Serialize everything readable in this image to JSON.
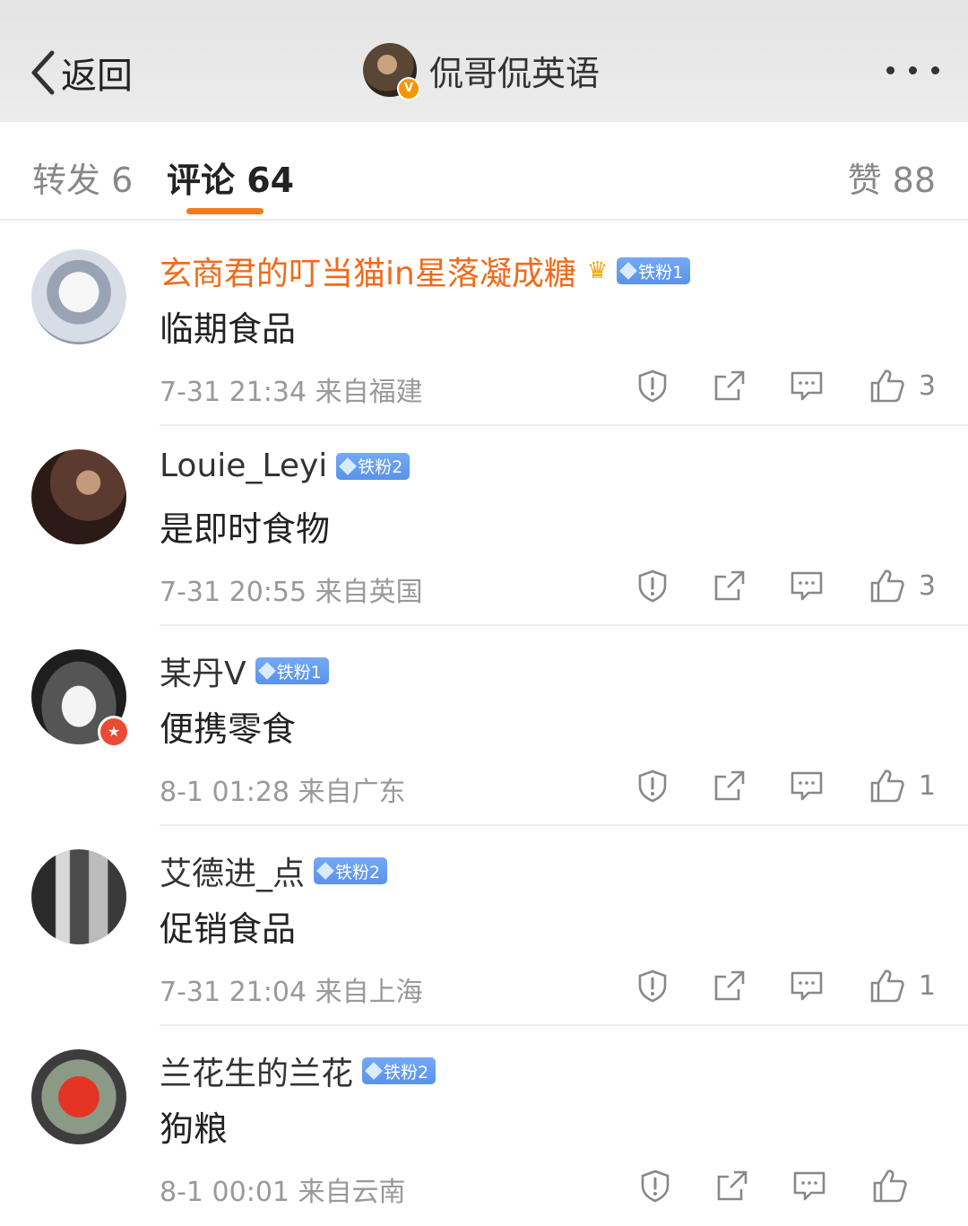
{
  "nav": {
    "back_label": "返回",
    "title": "侃哥侃英语",
    "verified_badge": "V"
  },
  "tabs": [
    {
      "label": "转发 6"
    },
    {
      "label": "评论 64"
    },
    {
      "label": "赞 88"
    }
  ],
  "accent_color": "#f07b1f",
  "comments": [
    {
      "name": "玄商君的叮当猫in星落凝成糖",
      "badge": "铁粉1",
      "text": "临期食品",
      "time": "7-31 21:34",
      "location": "来自福建",
      "likes": "3"
    },
    {
      "name": "Louie_Leyi",
      "badge": "铁粉2",
      "text": "是即时食物",
      "time": "7-31 20:55",
      "location": "来自英国",
      "likes": "3"
    },
    {
      "name": "某丹V",
      "badge": "铁粉1",
      "text": "便携零食",
      "time": "8-1 01:28",
      "location": "来自广东",
      "likes": "1"
    },
    {
      "name": "艾德进_点",
      "badge": "铁粉2",
      "text": "促销食品",
      "time": "7-31 21:04",
      "location": "来自上海",
      "likes": "1"
    },
    {
      "name": "兰花生的兰花",
      "badge": "铁粉2",
      "text": "狗粮",
      "time": "8-1 00:01",
      "location": "来自云南",
      "likes": ""
    }
  ]
}
